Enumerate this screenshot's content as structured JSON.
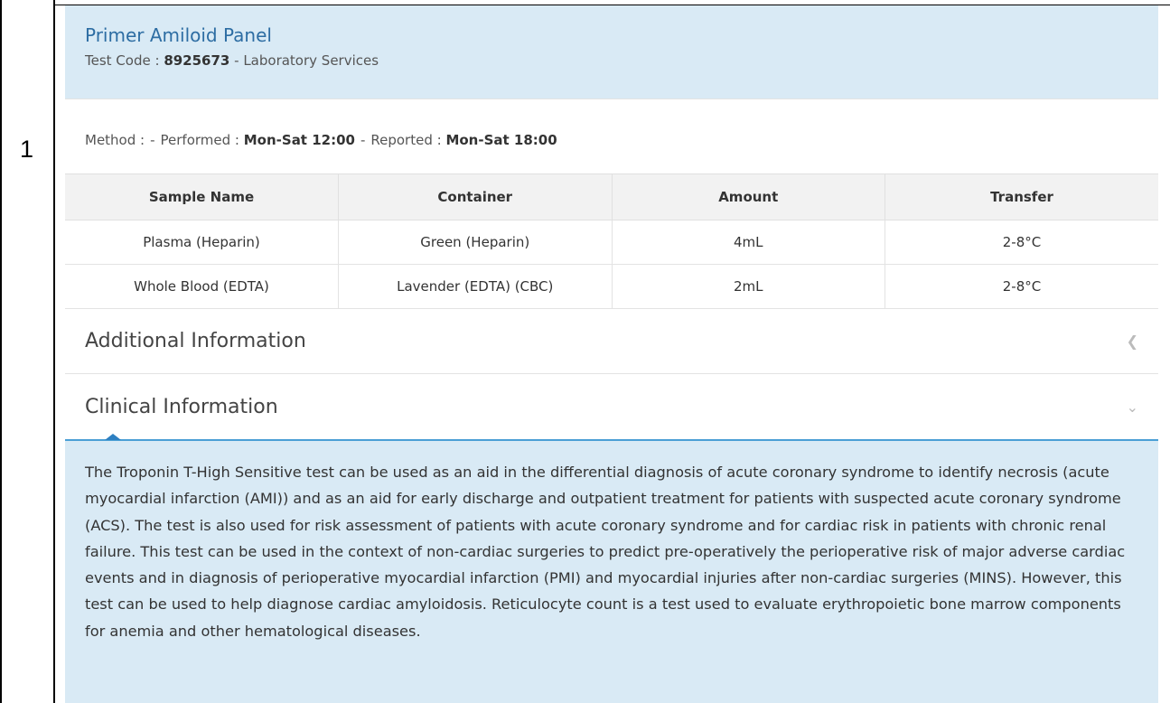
{
  "row_number": "1",
  "header": {
    "title": "Primer Amiloid Panel",
    "test_code_label": "Test Code : ",
    "test_code": "8925673",
    "service": " - Laboratory Services"
  },
  "method": {
    "method_label": "Method :",
    "method_value": "-",
    "performed_label": "Performed :",
    "performed_value": "Mon-Sat 12:00",
    "reported_label": "Reported :",
    "reported_value": "Mon-Sat 18:00",
    "separator": "-"
  },
  "table": {
    "columns": [
      "Sample Name",
      "Container",
      "Amount",
      "Transfer"
    ],
    "rows": [
      [
        "Plasma (Heparin)",
        "Green (Heparin)",
        "4mL",
        "2-8°C"
      ],
      [
        "Whole Blood (EDTA)",
        "Lavender (EDTA) (CBC)",
        "2mL",
        "2-8°C"
      ]
    ]
  },
  "accordion": {
    "additional": {
      "title": "Additional Information",
      "icon": "chevron-left-icon"
    },
    "clinical": {
      "title": "Clinical Information",
      "icon": "chevron-down-icon",
      "body": "The Troponin T-High Sensitive test can be used as an aid in the differential diagnosis of acute coronary syndrome to identify necrosis (acute myocardial infarction (AMI)) and as an aid for early discharge and outpatient treatment for patients with suspected acute coronary syndrome (ACS). The test is also used for risk assessment of patients with acute coronary syndrome and for cardiac risk in patients with chronic renal failure. This test can be used in the context of non-cardiac surgeries to predict pre-operatively the perioperative risk of major adverse cardiac events and in diagnosis of perioperative myocardial infarction (PMI) and myocardial injuries after non-cardiac surgeries (MINS). However, this test can be used to help diagnose cardiac amyloidosis. Reticulocyte count is a test used to evaluate erythropoietic bone marrow components for anemia and other hematological diseases."
    }
  },
  "colors": {
    "header_bg": "#d9eaf5",
    "title": "#2d6da3",
    "accent": "#4a9fd5"
  }
}
